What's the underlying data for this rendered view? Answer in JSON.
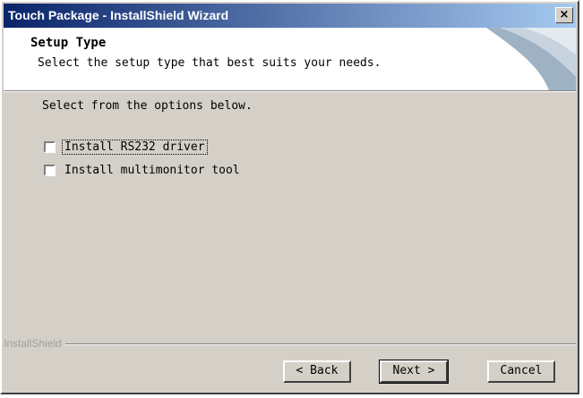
{
  "window": {
    "title": "Touch Package - InstallShield Wizard",
    "close_glyph": "×"
  },
  "header": {
    "title": "Setup Type",
    "subtitle": "Select the setup type that best suits your needs."
  },
  "body": {
    "instruction": "Select from the options below.",
    "options": [
      {
        "label": "Install RS232 driver",
        "checked": false
      },
      {
        "label": "Install multimonitor tool",
        "checked": false
      }
    ]
  },
  "footer": {
    "brand": "InstallShield",
    "back": "< Back",
    "next": "Next >",
    "cancel": "Cancel"
  },
  "colors": {
    "titlebar_start": "#0a246a",
    "titlebar_end": "#a6caf0",
    "dialog_bg": "#d4d0c8"
  },
  "icons": {
    "close": "close-icon",
    "header_graphic": "header-logo-icon"
  }
}
